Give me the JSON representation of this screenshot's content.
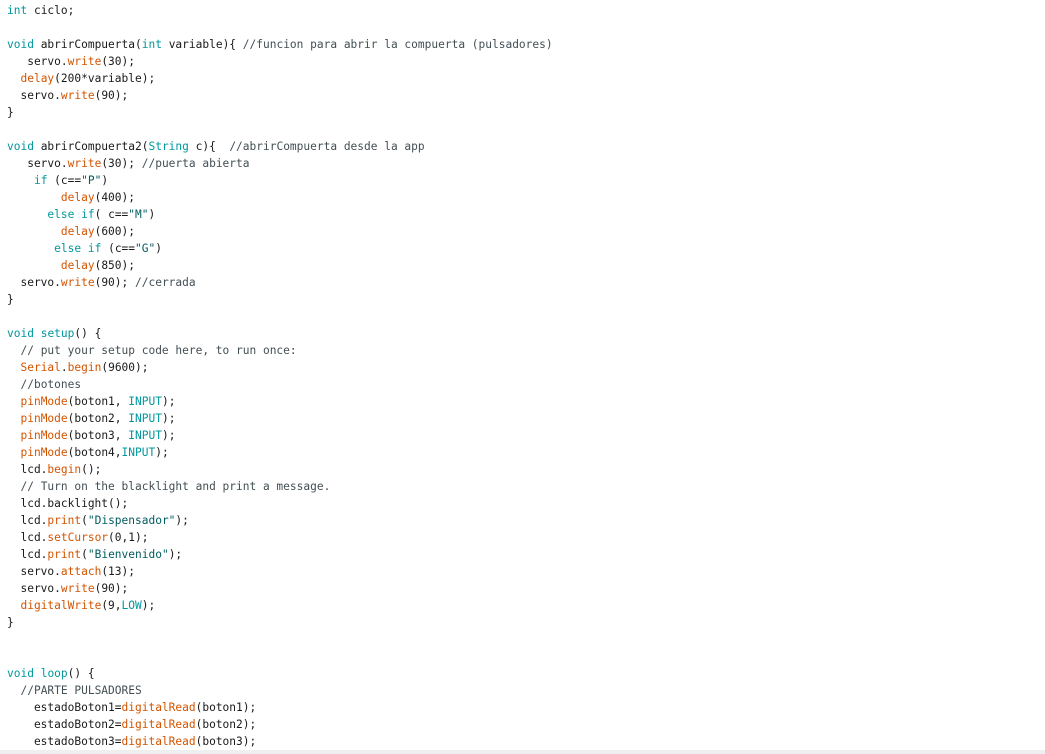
{
  "editor": {
    "lines": [
      [
        [
          "type",
          "int"
        ],
        [
          "txt",
          " ciclo;"
        ]
      ],
      [],
      [
        [
          "type",
          "void"
        ],
        [
          "txt",
          " abrirCompuerta("
        ],
        [
          "type",
          "int"
        ],
        [
          "txt",
          " variable){ "
        ],
        [
          "cmt",
          "//funcion para abrir la compuerta (pulsadores)"
        ]
      ],
      [
        [
          "txt",
          "   servo."
        ],
        [
          "fn",
          "write"
        ],
        [
          "txt",
          "(30);"
        ]
      ],
      [
        [
          "txt",
          "  "
        ],
        [
          "fn",
          "delay"
        ],
        [
          "txt",
          "(200*variable);"
        ]
      ],
      [
        [
          "txt",
          "  servo."
        ],
        [
          "fn",
          "write"
        ],
        [
          "txt",
          "(90);"
        ]
      ],
      [
        [
          "txt",
          "}"
        ]
      ],
      [],
      [
        [
          "type",
          "void"
        ],
        [
          "txt",
          " abrirCompuerta2("
        ],
        [
          "type",
          "String"
        ],
        [
          "txt",
          " c){  "
        ],
        [
          "cmt",
          "//abrirCompuerta desde la app"
        ]
      ],
      [
        [
          "txt",
          "   servo."
        ],
        [
          "fn",
          "write"
        ],
        [
          "txt",
          "(30); "
        ],
        [
          "cmt",
          "//puerta abierta"
        ]
      ],
      [
        [
          "txt",
          "    "
        ],
        [
          "kw",
          "if"
        ],
        [
          "txt",
          " (c=="
        ],
        [
          "str",
          "\"P\""
        ],
        [
          "txt",
          ")"
        ]
      ],
      [
        [
          "txt",
          "        "
        ],
        [
          "fn",
          "delay"
        ],
        [
          "txt",
          "(400);"
        ]
      ],
      [
        [
          "txt",
          "      "
        ],
        [
          "kw",
          "else"
        ],
        [
          "txt",
          " "
        ],
        [
          "kw",
          "if"
        ],
        [
          "txt",
          "( c=="
        ],
        [
          "str",
          "\"M\""
        ],
        [
          "txt",
          ")"
        ]
      ],
      [
        [
          "txt",
          "        "
        ],
        [
          "fn",
          "delay"
        ],
        [
          "txt",
          "(600);"
        ]
      ],
      [
        [
          "txt",
          "       "
        ],
        [
          "kw",
          "else"
        ],
        [
          "txt",
          " "
        ],
        [
          "kw",
          "if"
        ],
        [
          "txt",
          " (c=="
        ],
        [
          "str",
          "\"G\""
        ],
        [
          "txt",
          ")"
        ]
      ],
      [
        [
          "txt",
          "        "
        ],
        [
          "fn",
          "delay"
        ],
        [
          "txt",
          "(850);"
        ]
      ],
      [
        [
          "txt",
          "  servo."
        ],
        [
          "fn",
          "write"
        ],
        [
          "txt",
          "(90); "
        ],
        [
          "cmt",
          "//cerrada"
        ]
      ],
      [
        [
          "txt",
          "}"
        ]
      ],
      [],
      [
        [
          "type",
          "void"
        ],
        [
          "txt",
          " "
        ],
        [
          "kw",
          "setup"
        ],
        [
          "txt",
          "() {"
        ]
      ],
      [
        [
          "txt",
          "  "
        ],
        [
          "cmt",
          "// put your setup code here, to run once:"
        ]
      ],
      [
        [
          "txt",
          "  "
        ],
        [
          "fn",
          "Serial"
        ],
        [
          "txt",
          "."
        ],
        [
          "fn",
          "begin"
        ],
        [
          "txt",
          "(9600);"
        ]
      ],
      [
        [
          "txt",
          "  "
        ],
        [
          "cmt",
          "//botones"
        ]
      ],
      [
        [
          "txt",
          "  "
        ],
        [
          "fn",
          "pinMode"
        ],
        [
          "txt",
          "(boton1, "
        ],
        [
          "const",
          "INPUT"
        ],
        [
          "txt",
          ");"
        ]
      ],
      [
        [
          "txt",
          "  "
        ],
        [
          "fn",
          "pinMode"
        ],
        [
          "txt",
          "(boton2, "
        ],
        [
          "const",
          "INPUT"
        ],
        [
          "txt",
          ");"
        ]
      ],
      [
        [
          "txt",
          "  "
        ],
        [
          "fn",
          "pinMode"
        ],
        [
          "txt",
          "(boton3, "
        ],
        [
          "const",
          "INPUT"
        ],
        [
          "txt",
          ");"
        ]
      ],
      [
        [
          "txt",
          "  "
        ],
        [
          "fn",
          "pinMode"
        ],
        [
          "txt",
          "(boton4,"
        ],
        [
          "const",
          "INPUT"
        ],
        [
          "txt",
          ");"
        ]
      ],
      [
        [
          "txt",
          "  lcd."
        ],
        [
          "fn",
          "begin"
        ],
        [
          "txt",
          "();"
        ]
      ],
      [
        [
          "txt",
          "  "
        ],
        [
          "cmt",
          "// Turn on the blacklight and print a message."
        ]
      ],
      [
        [
          "txt",
          "  lcd.backlight();"
        ]
      ],
      [
        [
          "txt",
          "  lcd."
        ],
        [
          "fn",
          "print"
        ],
        [
          "txt",
          "("
        ],
        [
          "str",
          "\"Dispensador\""
        ],
        [
          "txt",
          ");"
        ]
      ],
      [
        [
          "txt",
          "  lcd."
        ],
        [
          "fn",
          "setCursor"
        ],
        [
          "txt",
          "(0,1);"
        ]
      ],
      [
        [
          "txt",
          "  lcd."
        ],
        [
          "fn",
          "print"
        ],
        [
          "txt",
          "("
        ],
        [
          "str",
          "\"Bienvenido\""
        ],
        [
          "txt",
          ");"
        ]
      ],
      [
        [
          "txt",
          "  servo."
        ],
        [
          "fn",
          "attach"
        ],
        [
          "txt",
          "(13);"
        ]
      ],
      [
        [
          "txt",
          "  servo."
        ],
        [
          "fn",
          "write"
        ],
        [
          "txt",
          "(90);"
        ]
      ],
      [
        [
          "txt",
          "  "
        ],
        [
          "fn",
          "digitalWrite"
        ],
        [
          "txt",
          "(9,"
        ],
        [
          "const",
          "LOW"
        ],
        [
          "txt",
          ");"
        ]
      ],
      [
        [
          "txt",
          "}"
        ]
      ],
      [],
      [],
      [
        [
          "type",
          "void"
        ],
        [
          "txt",
          " "
        ],
        [
          "kw",
          "loop"
        ],
        [
          "txt",
          "() {"
        ]
      ],
      [
        [
          "txt",
          "  "
        ],
        [
          "cmt",
          "//PARTE PULSADORES"
        ]
      ],
      [
        [
          "txt",
          "    estadoBoton1="
        ],
        [
          "fn",
          "digitalRead"
        ],
        [
          "txt",
          "(boton1);"
        ]
      ],
      [
        [
          "txt",
          "    estadoBoton2="
        ],
        [
          "fn",
          "digitalRead"
        ],
        [
          "txt",
          "(boton2);"
        ]
      ],
      [
        [
          "txt",
          "    estadoBoton3="
        ],
        [
          "fn",
          "digitalRead"
        ],
        [
          "txt",
          "(boton3);"
        ]
      ]
    ]
  }
}
